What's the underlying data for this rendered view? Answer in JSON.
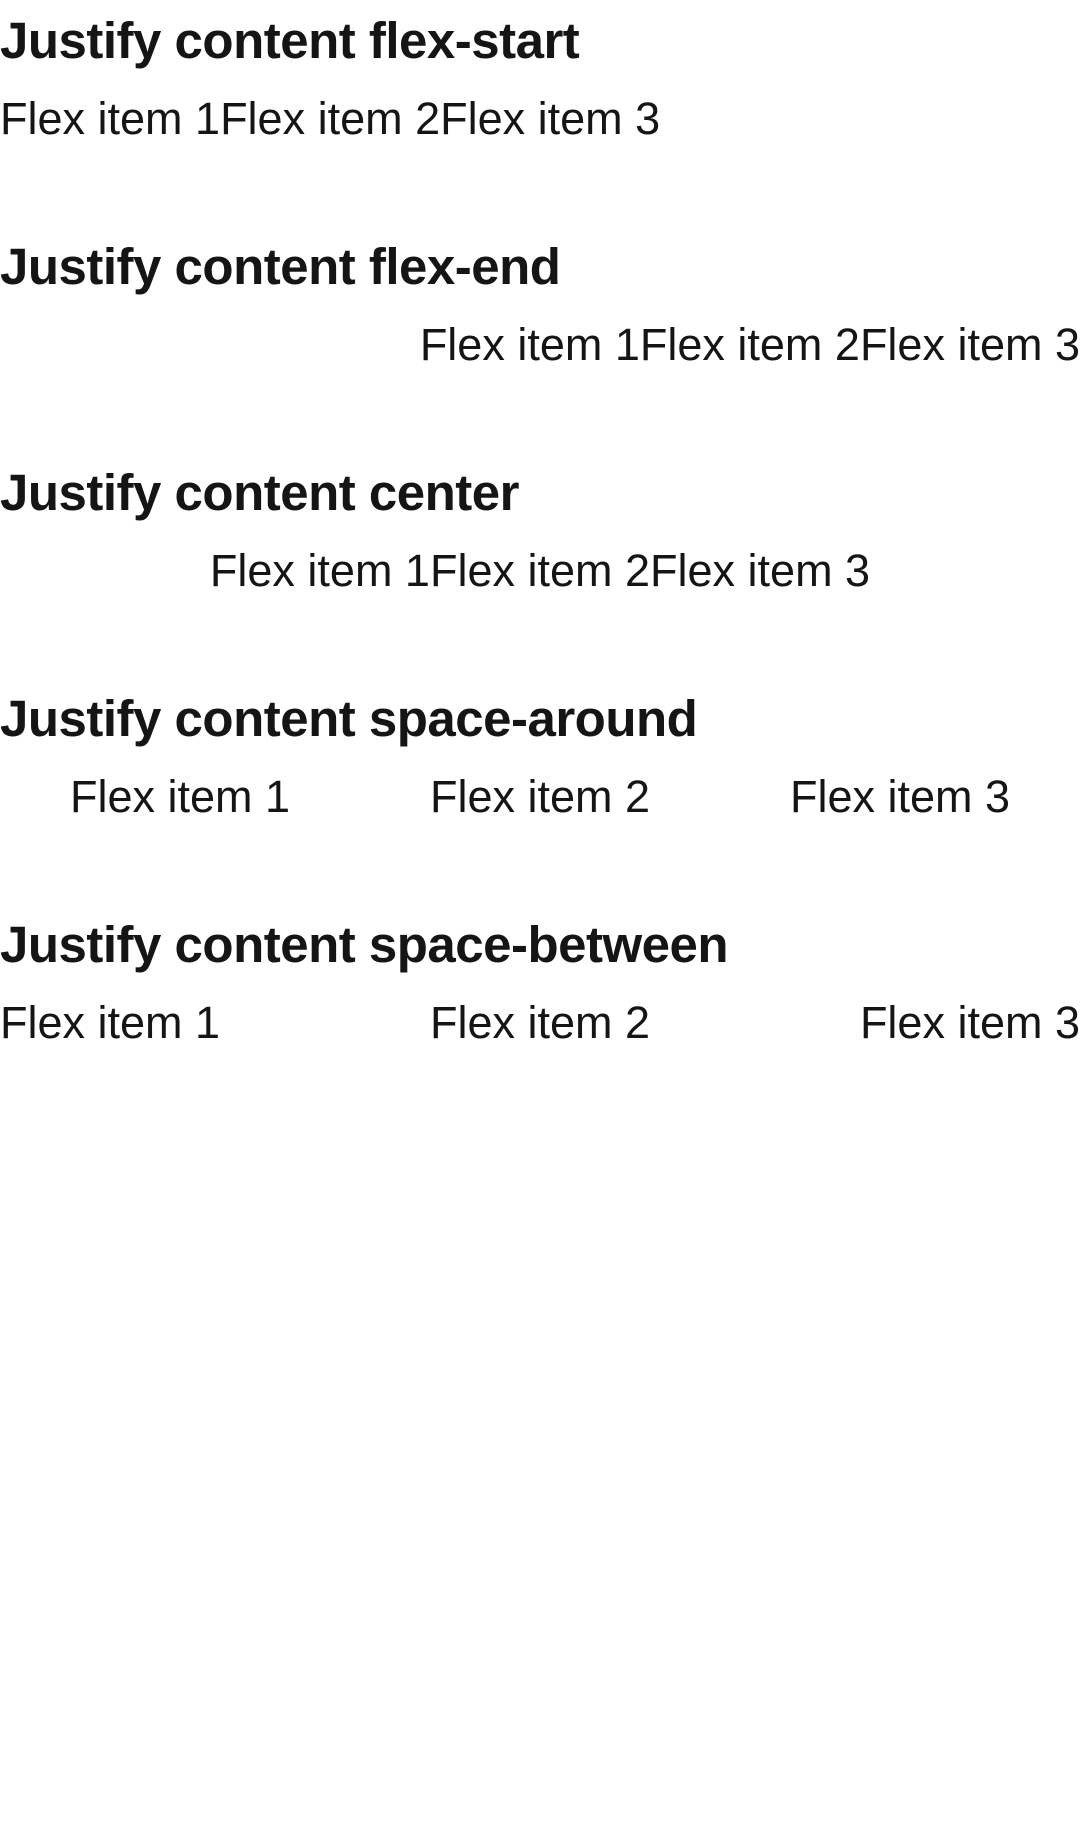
{
  "examples": [
    {
      "heading": "Justify content flex-start",
      "items": [
        "Flex item 1",
        "Flex item 2",
        "Flex item 3"
      ]
    },
    {
      "heading": "Justify content flex-end",
      "items": [
        "Flex item 1",
        "Flex item 2",
        "Flex item 3"
      ]
    },
    {
      "heading": "Justify content center",
      "items": [
        "Flex item 1",
        "Flex item 2",
        "Flex item 3"
      ]
    },
    {
      "heading": "Justify content space-around",
      "items": [
        "Flex item 1",
        "Flex item 2",
        "Flex item 3"
      ]
    },
    {
      "heading": "Justify content space-between",
      "items": [
        "Flex item 1",
        "Flex item 2",
        "Flex item 3"
      ]
    }
  ]
}
